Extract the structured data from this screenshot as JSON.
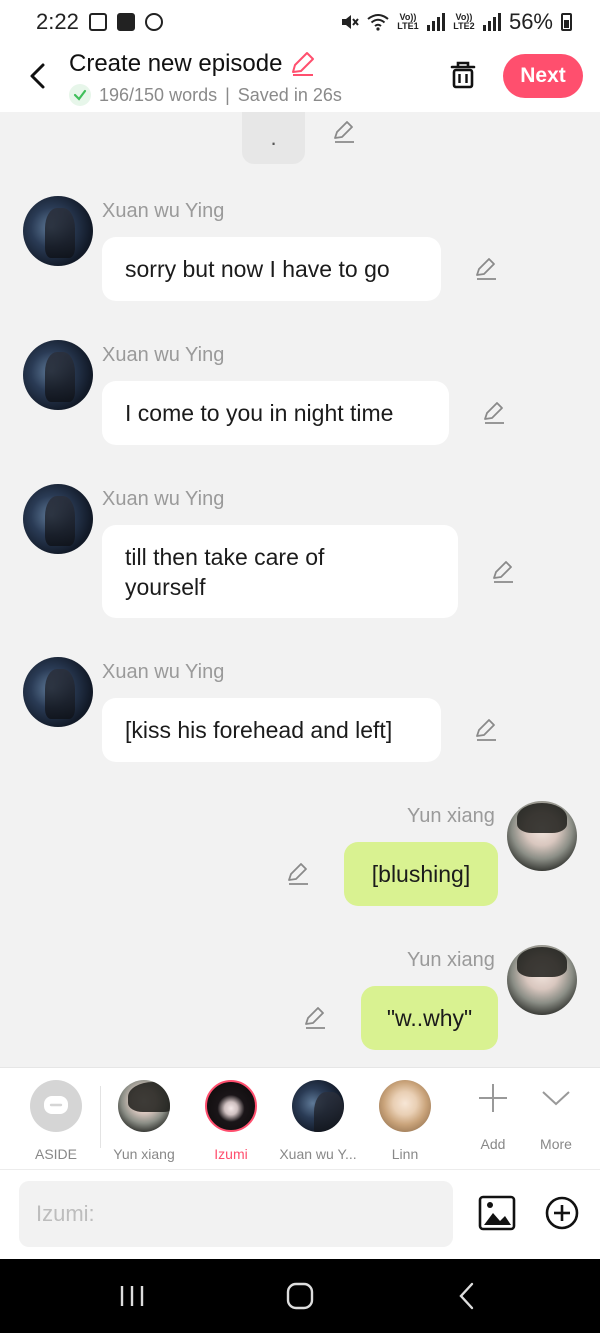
{
  "status": {
    "time": "2:22",
    "lte1": "Vo)) LTE1",
    "lte2": "Vo)) LTE2",
    "battery": "56%"
  },
  "header": {
    "title": "Create new episode",
    "words": "196/150 words",
    "saved": "Saved in 26s",
    "separator": "|",
    "next_label": "Next"
  },
  "chat": {
    "top_bubble": ".",
    "messages": [
      {
        "sender": "Xuan wu Ying",
        "text": "sorry but now I have to go",
        "side": "left"
      },
      {
        "sender": "Xuan wu Ying",
        "text": "I come to you in night time",
        "side": "left"
      },
      {
        "sender": "Xuan wu Ying",
        "text": "till then take care of yourself",
        "side": "left"
      },
      {
        "sender": "Xuan wu Ying",
        "text": "[kiss his forehead and left]",
        "side": "left"
      },
      {
        "sender": "Yun xiang",
        "text": "[blushing]",
        "side": "right"
      },
      {
        "sender": "Yun xiang",
        "text": "\"w..why\"",
        "side": "right"
      }
    ]
  },
  "characters": [
    {
      "label": "ASIDE",
      "active": false
    },
    {
      "label": "Yun xiang",
      "active": false
    },
    {
      "label": "Izumi",
      "active": true
    },
    {
      "label": "Xuan wu Y...",
      "active": false
    },
    {
      "label": "Linn",
      "active": false
    }
  ],
  "actions": {
    "add_label": "Add",
    "more_label": "More"
  },
  "input": {
    "placeholder": "Izumi:"
  },
  "colors": {
    "accent": "#ff4f6e",
    "user_bubble": "#d9f291",
    "background": "#f2f2f2"
  }
}
